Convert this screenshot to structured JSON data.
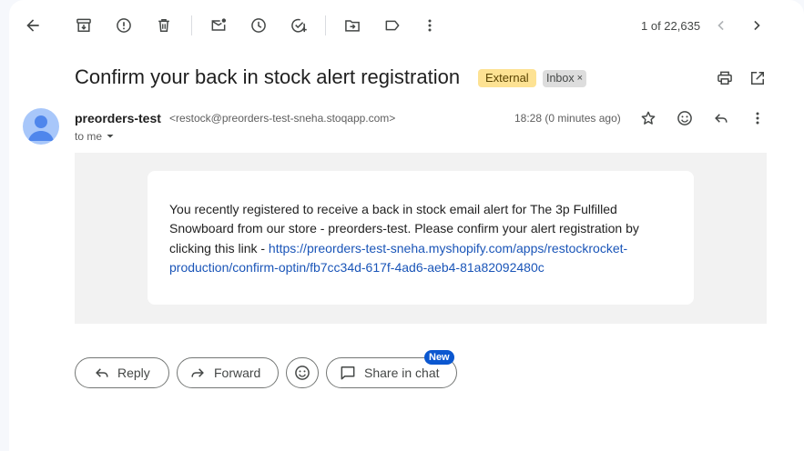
{
  "toolbar": {
    "pagination": "1 of 22,635"
  },
  "email": {
    "subject": "Confirm your back in stock alert registration",
    "labels": {
      "external": "External",
      "inbox": "Inbox",
      "inbox_remove": "×"
    },
    "sender_name": "preorders-test",
    "sender_email": "<restock@preorders-test-sneha.stoqapp.com>",
    "recipient": "to me",
    "time": "18:28 (0 minutes ago)",
    "body_text": "You recently registered to receive a back in stock email alert for The 3p Fulfilled Snowboard from our store - preorders-test. Please confirm your alert registration by clicking this link - ",
    "body_link": "https://preorders-test-sneha.myshopify.com/apps/restockrocket-production/confirm-optin/fb7cc34d-617f-4ad6-aeb4-81a82092480c"
  },
  "actions": {
    "reply": "Reply",
    "forward": "Forward",
    "share_in_chat": "Share in chat",
    "new_badge": "New"
  },
  "icons": {
    "back": "arrow-left-icon",
    "archive": "archive-icon",
    "spam": "report-spam-icon",
    "delete": "trash-icon",
    "mark_unread": "mark-unread-icon",
    "snooze": "clock-icon",
    "add_task": "add-task-icon",
    "move": "move-to-folder-icon",
    "label": "label-icon",
    "more": "more-vert-icon"
  },
  "colors": {
    "external_label_bg": "#fde293",
    "link": "#1a55b8",
    "new_badge": "#0b57d0",
    "avatar": "#a8c7fa"
  }
}
